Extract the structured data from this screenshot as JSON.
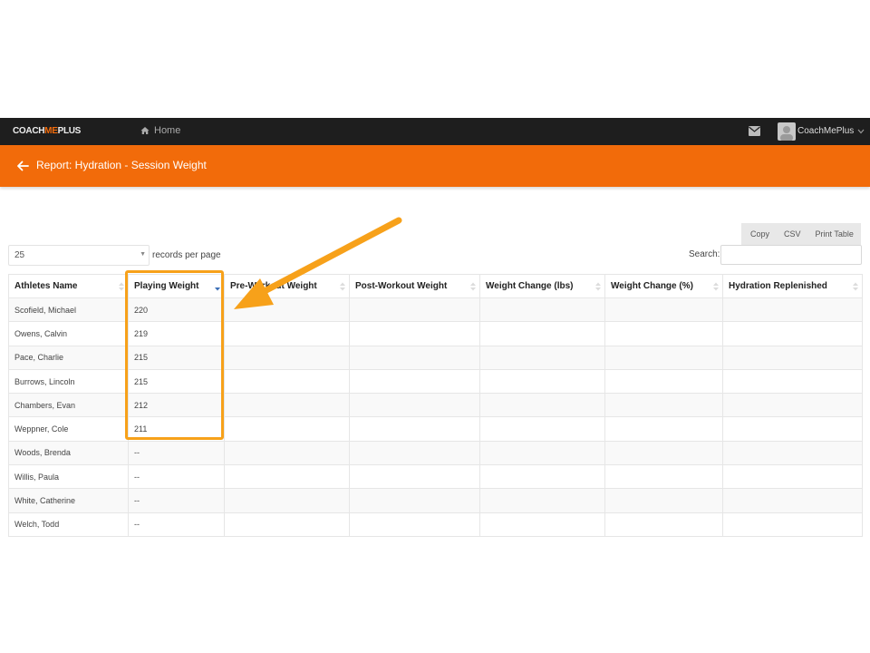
{
  "app": {
    "logo_prefix": "COACH",
    "logo_accent": "ME",
    "logo_suffix": "PLUS",
    "home_label": "Home",
    "user_name": "CoachMePlus"
  },
  "header": {
    "title": "Report: Hydration - Session Weight"
  },
  "toolbar": {
    "copy_label": "Copy",
    "csv_label": "CSV",
    "print_label": "Print Table"
  },
  "controls": {
    "records_value": "25",
    "records_label": "records per page",
    "search_label": "Search:",
    "search_value": ""
  },
  "table": {
    "columns": [
      "Athletes Name",
      "Playing Weight",
      "Pre-Workout Weight",
      "Post-Workout Weight",
      "Weight Change (lbs)",
      "Weight Change (%)",
      "Hydration Replenished"
    ],
    "sorted_column": 1,
    "rows": [
      [
        "Scofield, Michael",
        "220",
        "",
        "",
        "",
        "",
        ""
      ],
      [
        "Owens, Calvin",
        "219",
        "",
        "",
        "",
        "",
        ""
      ],
      [
        "Pace, Charlie",
        "215",
        "",
        "",
        "",
        "",
        ""
      ],
      [
        "Burrows, Lincoln",
        "215",
        "",
        "",
        "",
        "",
        ""
      ],
      [
        "Chambers, Evan",
        "212",
        "",
        "",
        "",
        "",
        ""
      ],
      [
        "Weppner, Cole",
        "211",
        "",
        "",
        "",
        "",
        ""
      ],
      [
        "Woods, Brenda",
        "--",
        "",
        "",
        "",
        "",
        ""
      ],
      [
        "Willis, Paula",
        "--",
        "",
        "",
        "",
        "",
        ""
      ],
      [
        "White, Catherine",
        "--",
        "",
        "",
        "",
        "",
        ""
      ],
      [
        "Welch, Todd",
        "--",
        "",
        "",
        "",
        "",
        ""
      ]
    ]
  },
  "colors": {
    "brand_orange": "#f26b0a",
    "annotation_orange": "#f7a11a",
    "topbar": "#1e1e1e"
  },
  "icons": [
    "home-icon",
    "mail-icon",
    "avatar",
    "chevron-down-icon",
    "back-arrow-icon",
    "sort-icon",
    "annotation-arrow"
  ]
}
